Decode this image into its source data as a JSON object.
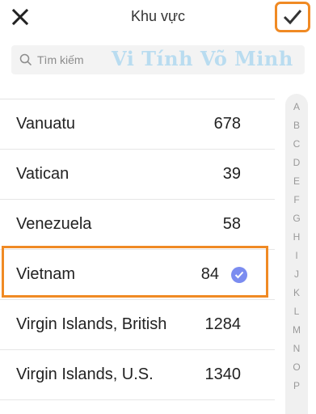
{
  "header": {
    "title": "Khu vực"
  },
  "search": {
    "placeholder": "Tìm kiếm",
    "watermark": "Vi Tính Võ Minh"
  },
  "countries": [
    {
      "name": "Vanuatu",
      "code": "678",
      "selected": false
    },
    {
      "name": "Vatican",
      "code": "39",
      "selected": false
    },
    {
      "name": "Venezuela",
      "code": "58",
      "selected": false
    },
    {
      "name": "Vietnam",
      "code": "84",
      "selected": true
    },
    {
      "name": "Virgin Islands, British",
      "code": "1284",
      "selected": false
    },
    {
      "name": "Virgin Islands, U.S.",
      "code": "1340",
      "selected": false
    }
  ],
  "index": [
    "A",
    "B",
    "C",
    "D",
    "E",
    "F",
    "G",
    "H",
    "I",
    "J",
    "K",
    "L",
    "M",
    "N",
    "O",
    "P"
  ],
  "colors": {
    "highlight": "#f08a24",
    "selected_badge": "#7b8cf0"
  },
  "icons": {
    "close": "close-icon",
    "confirm": "checkmark-icon",
    "search": "search-icon",
    "selected": "selected-check-icon"
  }
}
